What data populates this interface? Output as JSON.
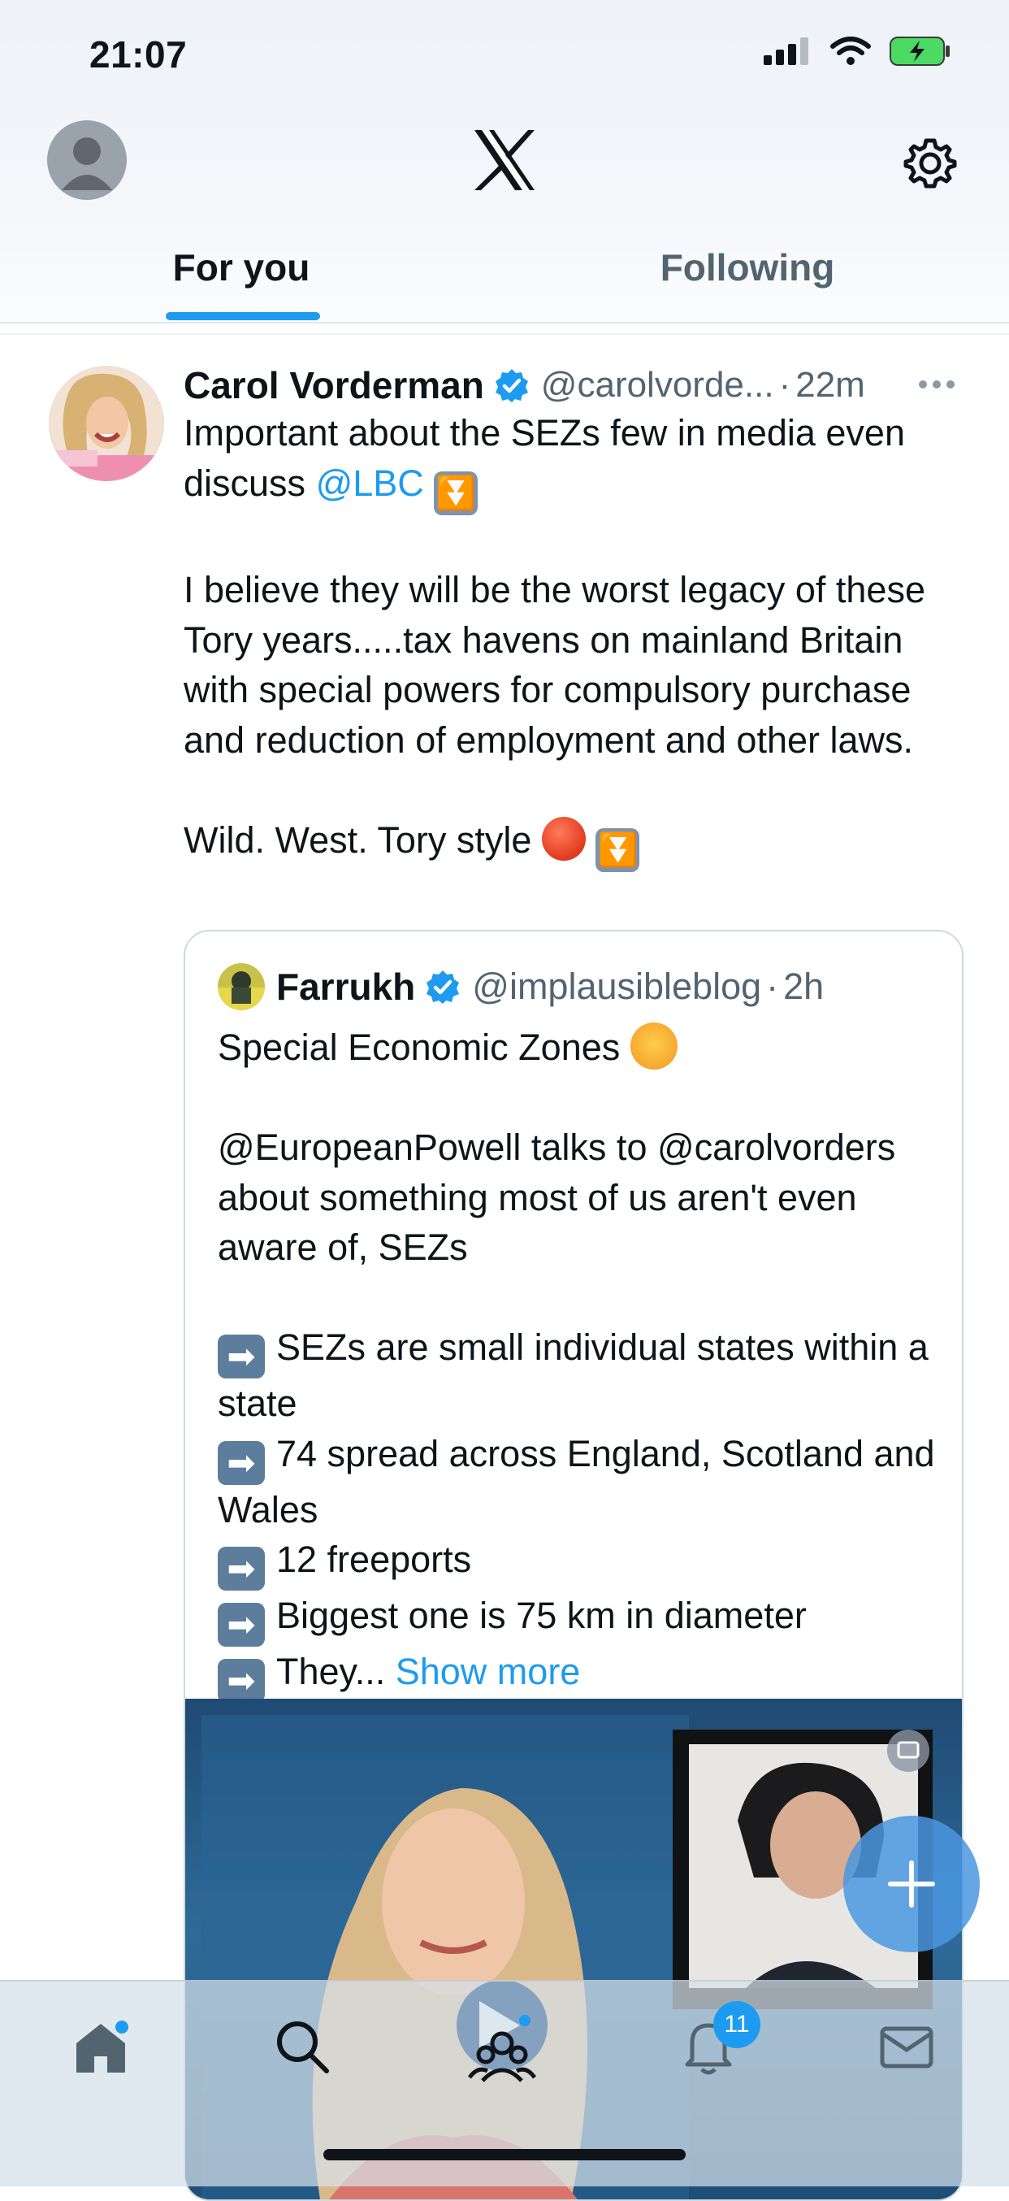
{
  "status": {
    "time": "21:07"
  },
  "header": {
    "tabs": [
      {
        "label": "For you",
        "active": true
      },
      {
        "label": "Following",
        "active": false
      }
    ]
  },
  "tweet": {
    "author": "Carol Vorderman",
    "handle": "@carolvorde...",
    "sep": "·",
    "time": "22m",
    "line1": "Important about the SEZs few in media even discuss ",
    "mention": "@LBC",
    "para2": "I believe they will be the worst legacy of these Tory years.....tax havens on mainland Britain with special powers for compulsory purchase and reduction of employment and other laws.",
    "para3": "Wild. West.  Tory style "
  },
  "quote": {
    "author": "Farrukh",
    "handle": "@implausibleblog",
    "sep": "·",
    "time": "2h",
    "line1": "Special Economic Zones ",
    "para2": "@EuropeanPowell talks to @carolvorders about something most of us aren't even aware of, SEZs",
    "bullets": [
      "SEZs are small individual states within a state",
      "74 spread across England, Scotland and Wales",
      "12 freeports",
      "Biggest one is 75 km in diameter",
      "They..."
    ],
    "show_more": "Show more"
  },
  "nav": {
    "notification_count": "11"
  },
  "colors": {
    "accent": "#1d9bf0",
    "text": "#0f1419",
    "secondary": "#536471"
  }
}
